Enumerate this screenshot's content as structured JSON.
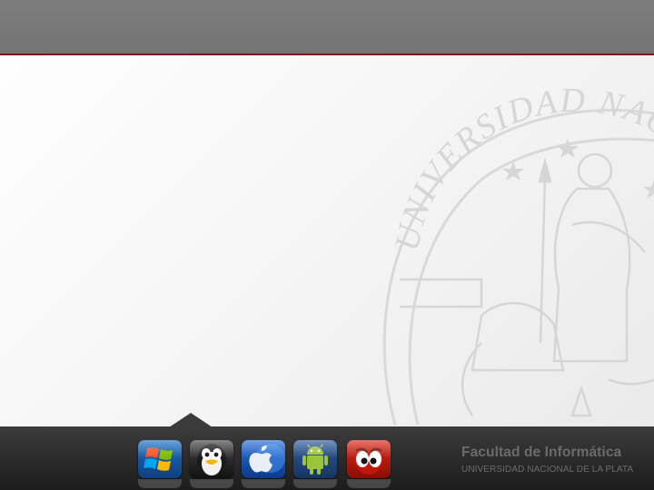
{
  "header": {
    "bar_color": "#777777",
    "rule_color": "#7a1a1a"
  },
  "watermark": {
    "seal_text": "UNIVERSIDAD NACIONAL",
    "icon": "university-seal-icon"
  },
  "dock": {
    "items": [
      {
        "id": "windows",
        "icon": "windows-logo-icon"
      },
      {
        "id": "linux",
        "icon": "tux-penguin-icon"
      },
      {
        "id": "mac",
        "icon": "apple-logo-icon"
      },
      {
        "id": "android",
        "icon": "android-robot-icon"
      },
      {
        "id": "freebsd",
        "icon": "bsd-daemon-icon"
      }
    ]
  },
  "branding": {
    "title": "Facultad de Informática",
    "subtitle": "UNIVERSIDAD NACIONAL DE LA PLATA"
  }
}
